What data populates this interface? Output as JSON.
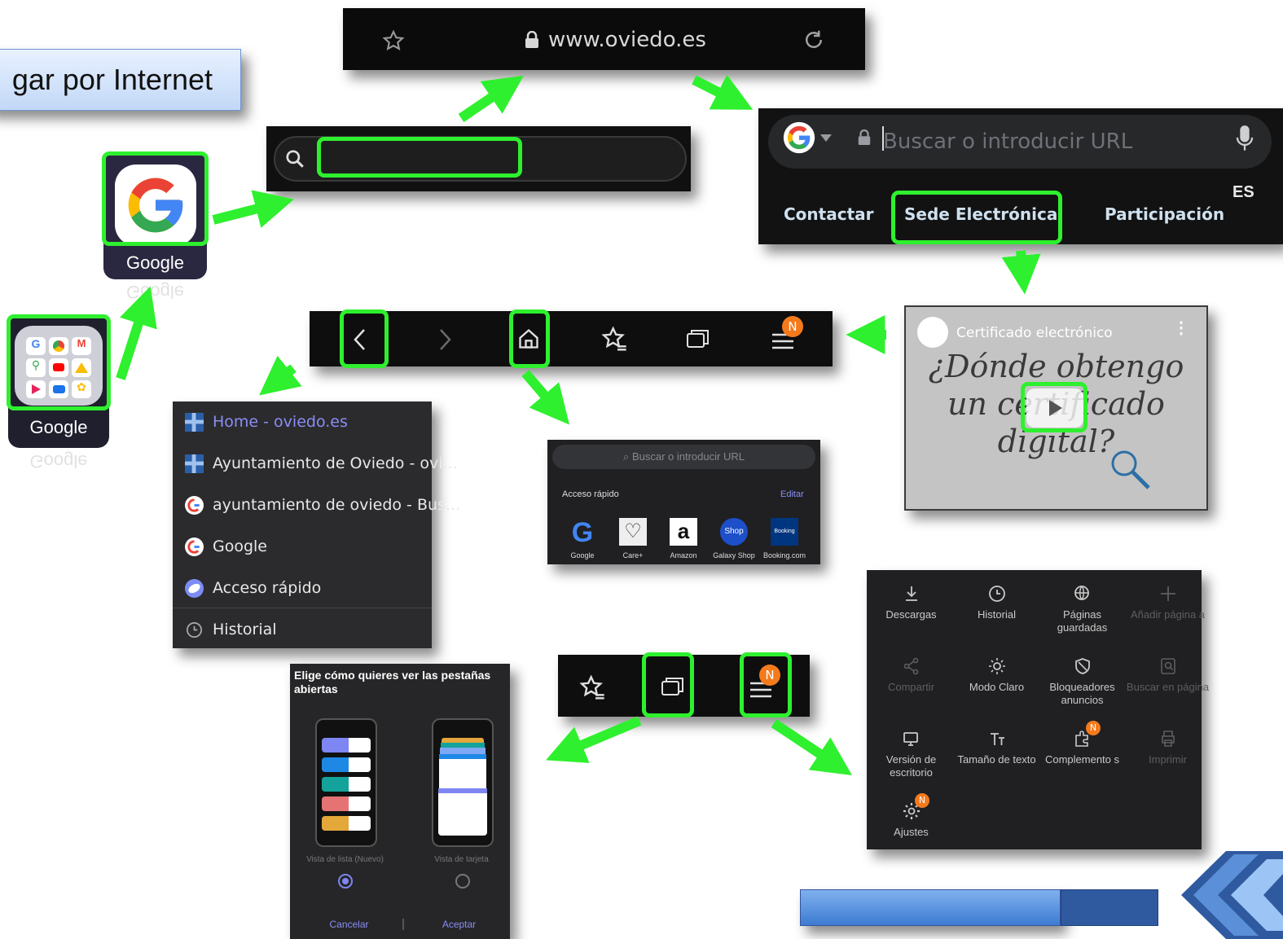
{
  "title_box": {
    "text": "gar por Internet"
  },
  "app_icons": {
    "google_app_label": "Google",
    "google_folder_label": "Google"
  },
  "url_bar": {
    "url": "www.oviedo.es"
  },
  "browser": {
    "placeholder": "Buscar o introducir URL",
    "nav_items": [
      "Contactar",
      "Sede Electrónica",
      "Participación"
    ],
    "lang": "ES"
  },
  "video": {
    "channel": "Certificado electrónico",
    "line1": "¿Dónde obtengo",
    "line2": "un certificado",
    "line3": "digital?"
  },
  "badges": {
    "n": "N"
  },
  "history": [
    {
      "label": "Home - oviedo.es",
      "icon": "oviedo-icon",
      "active": true
    },
    {
      "label": "Ayuntamiento de Oviedo - ovi...",
      "icon": "oviedo-icon",
      "active": false
    },
    {
      "label": "ayuntamiento de oviedo - Bus...",
      "icon": "google-g-icon",
      "active": false
    },
    {
      "label": "Google",
      "icon": "google-g-icon",
      "active": false
    },
    {
      "label": "Acceso rápido",
      "icon": "samsung-internet-icon",
      "active": false
    },
    {
      "label": "Historial",
      "icon": "clock-icon",
      "active": false
    }
  ],
  "quick_access": {
    "search_placeholder": "Buscar o introducir URL",
    "title": "Acceso rápido",
    "edit": "Editar",
    "items": [
      "Google",
      "Care+",
      "Amazon",
      "Galaxy Shop",
      "Booking.com"
    ]
  },
  "menu_grid": [
    {
      "label": "Descargas",
      "icon": "download-icon",
      "dim": false
    },
    {
      "label": "Historial",
      "icon": "clock-icon",
      "dim": false
    },
    {
      "label": "Páginas guardadas",
      "icon": "globe-icon",
      "dim": false
    },
    {
      "label": "Añadir página a",
      "icon": "plus-icon",
      "dim": true
    },
    {
      "label": "Compartir",
      "icon": "share-icon",
      "dim": true
    },
    {
      "label": "Modo Claro",
      "icon": "sun-icon",
      "dim": false
    },
    {
      "label": "Bloqueadores anuncios",
      "icon": "shield-icon",
      "dim": false
    },
    {
      "label": "Buscar en página",
      "icon": "find-icon",
      "dim": true
    },
    {
      "label": "Versión de escritorio",
      "icon": "desktop-icon",
      "dim": false
    },
    {
      "label": "Tamaño de texto",
      "icon": "text-size-icon",
      "dim": false
    },
    {
      "label": "Complemento s",
      "icon": "addons-icon",
      "dim": false
    },
    {
      "label": "Imprimir",
      "icon": "print-icon",
      "dim": true
    },
    {
      "label": "Ajustes",
      "icon": "gear-icon",
      "dim": false
    }
  ],
  "tabs_view": {
    "title": "Elige cómo quieres ver las pestañas abiertas",
    "list_label": "Vista de lista (Nuevo)",
    "card_label": "Vista de tarjeta",
    "cancel": "Cancelar",
    "accept": "Aceptar"
  },
  "colors": {
    "highlight": "#2ef02e",
    "badge": "#f47a1c",
    "link_active": "#8a8df5"
  }
}
